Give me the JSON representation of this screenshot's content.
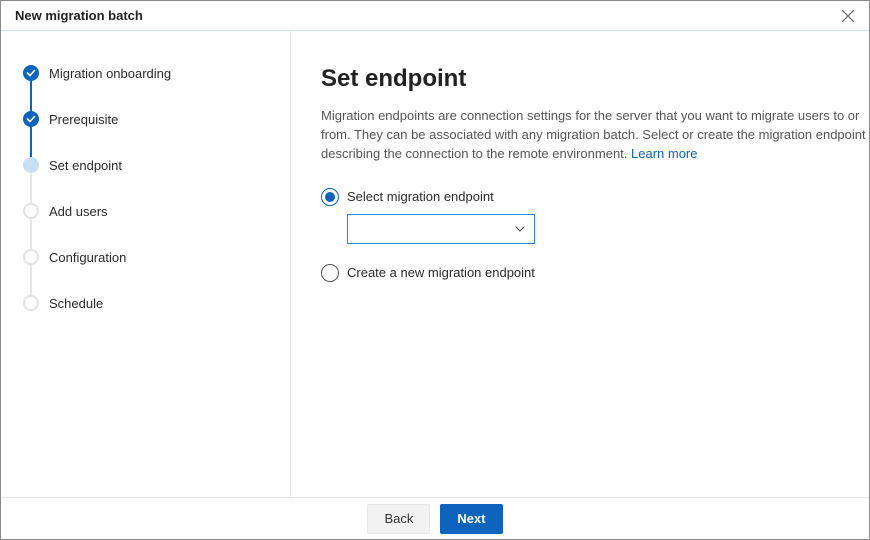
{
  "title": "New migration batch",
  "steps": [
    {
      "label": "Migration onboarding",
      "state": "done"
    },
    {
      "label": "Prerequisite",
      "state": "done"
    },
    {
      "label": "Set endpoint",
      "state": "current"
    },
    {
      "label": "Add users",
      "state": "future"
    },
    {
      "label": "Configuration",
      "state": "future"
    },
    {
      "label": "Schedule",
      "state": "future"
    }
  ],
  "main": {
    "heading": "Set endpoint",
    "description": "Migration endpoints are connection settings for the server that you want to migrate users to or from. They can be associated with any migration batch. Select or create the migration endpoint describing the connection to the remote environment. ",
    "learn_more": "Learn more",
    "radio_select_label": "Select migration endpoint",
    "radio_create_label": "Create a new migration endpoint",
    "selected_option": "select",
    "dropdown_value": ""
  },
  "footer": {
    "back": "Back",
    "next": "Next"
  }
}
